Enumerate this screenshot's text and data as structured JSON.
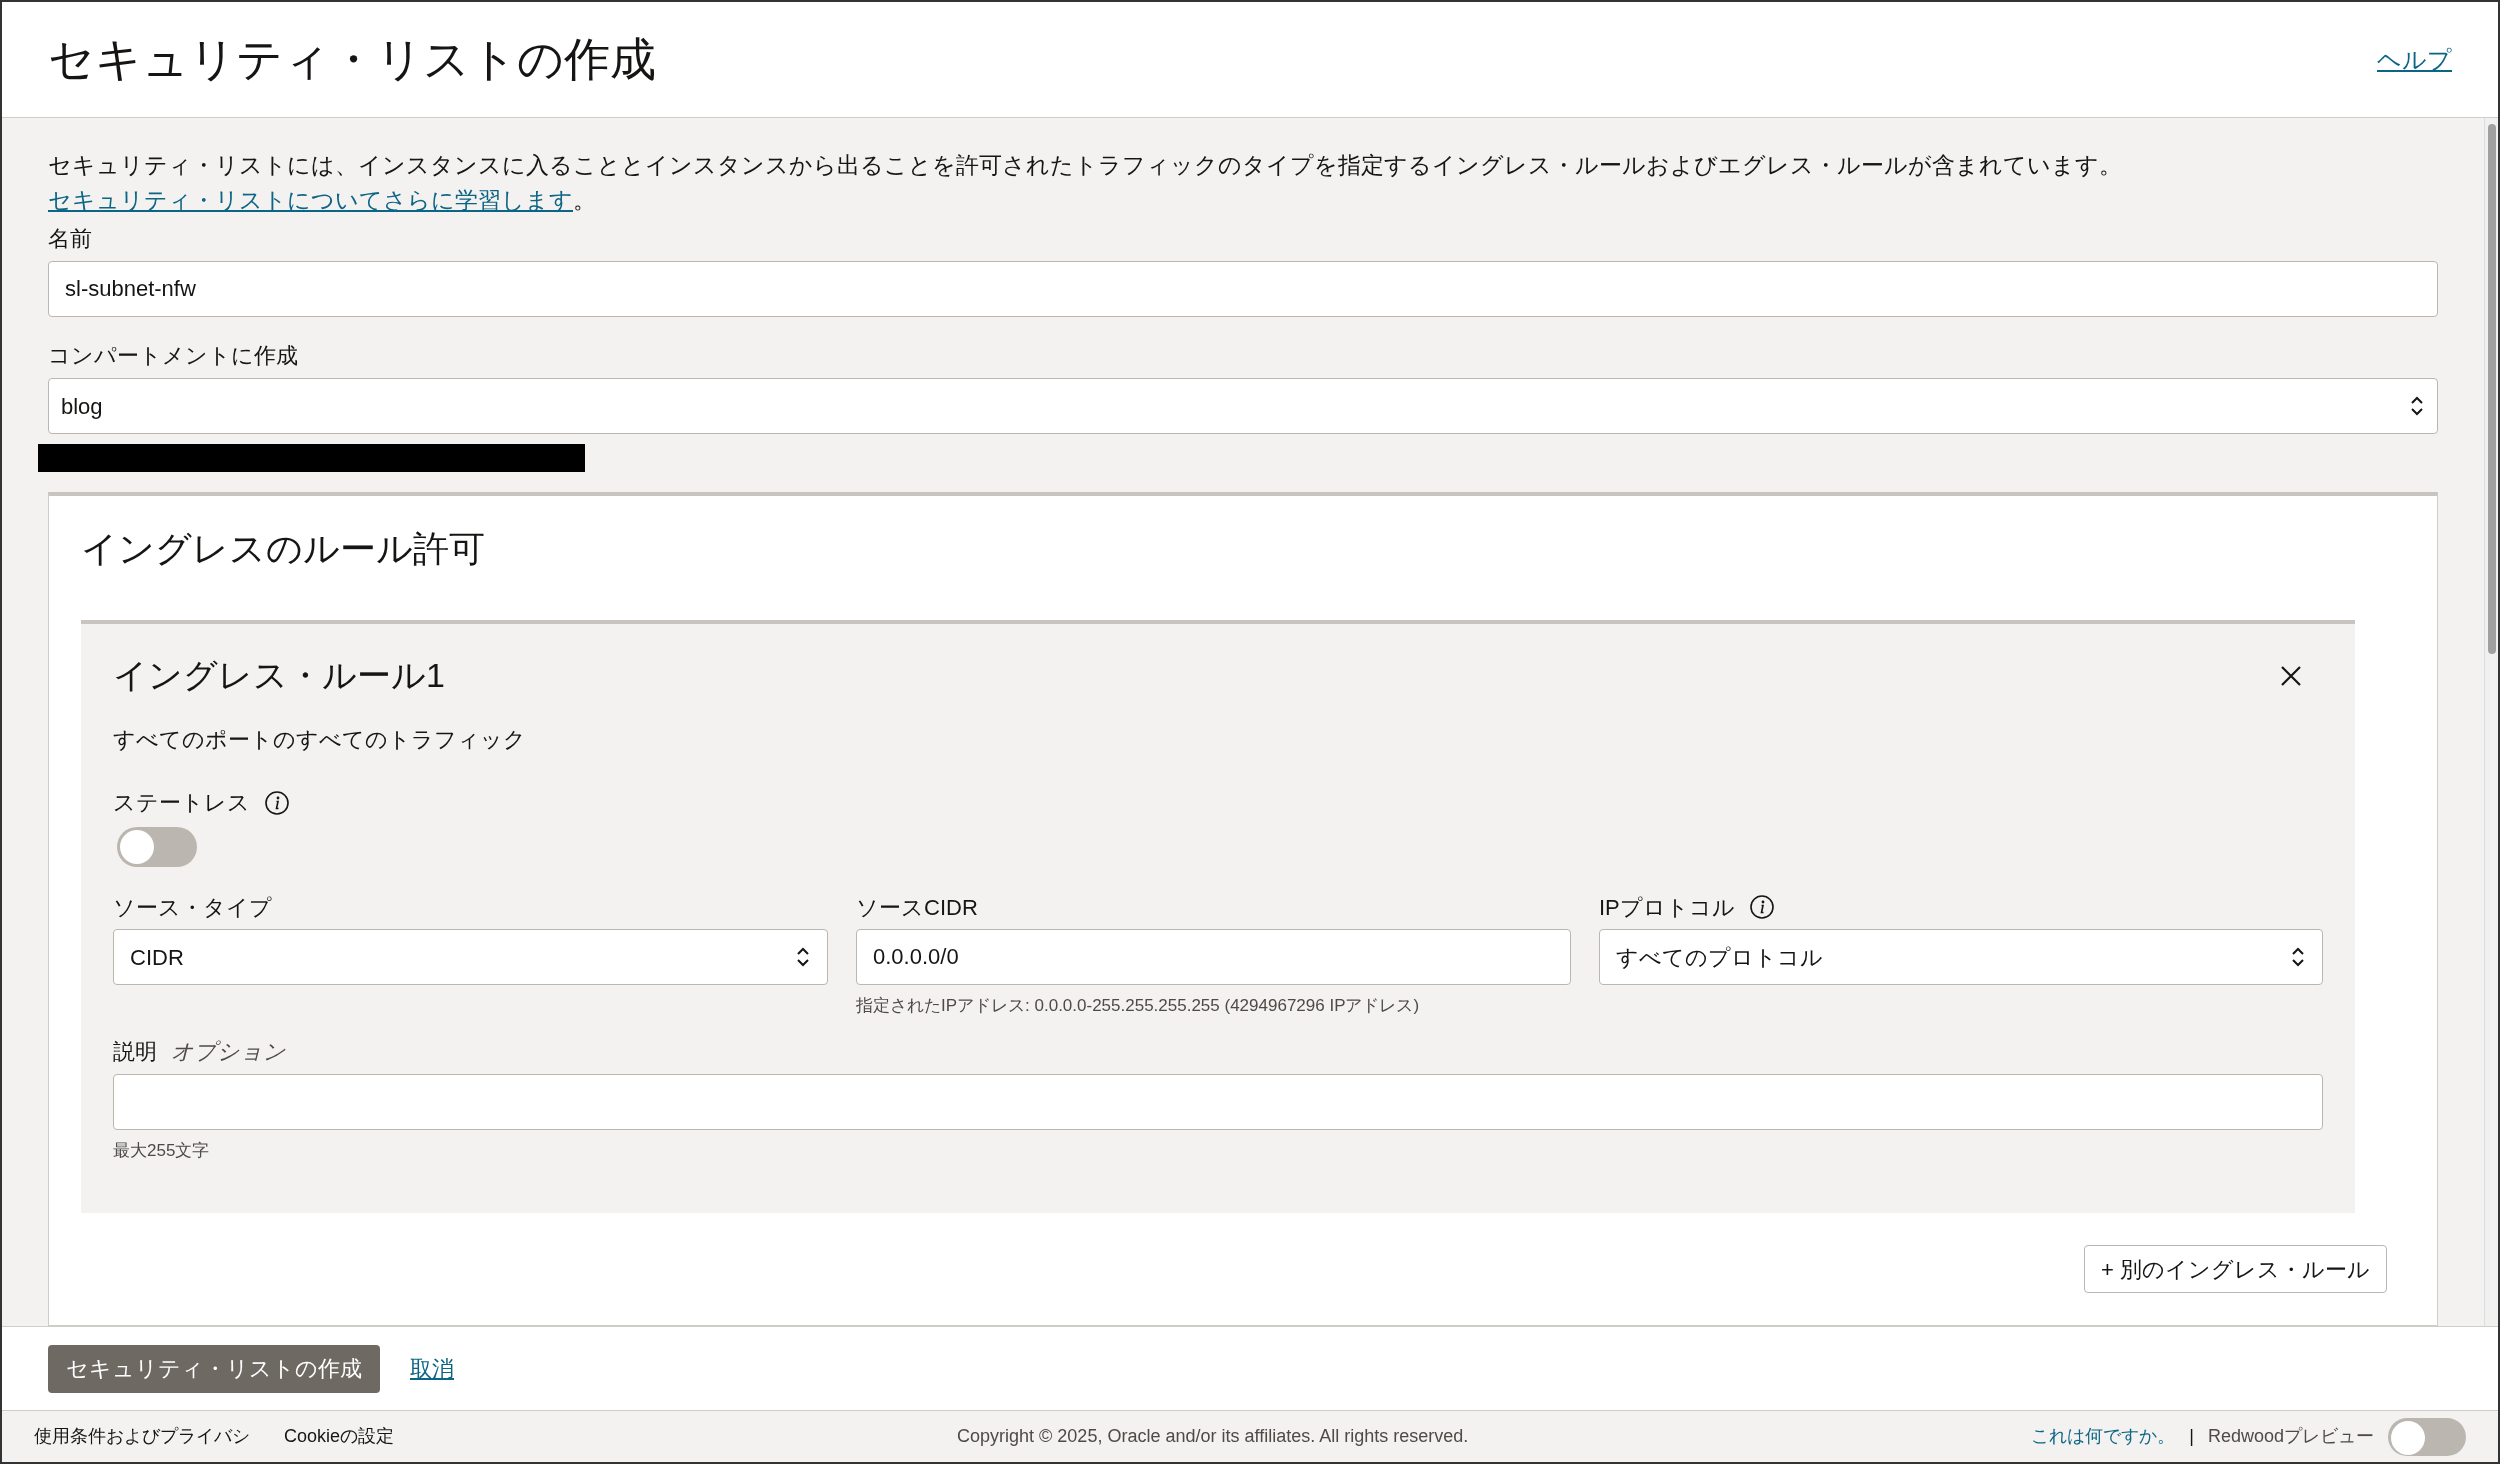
{
  "header": {
    "title": "セキュリティ・リストの作成",
    "help_link": "ヘルプ"
  },
  "intro": {
    "text": "セキュリティ・リストには、インスタンスに入ることとインスタンスから出ることを許可されたトラフィックのタイプを指定するイングレス・ルールおよびエグレス・ルールが含まれています。",
    "link": "セキュリティ・リストについてさらに学習します",
    "end": "。"
  },
  "name_field": {
    "label": "名前",
    "value": "sl-subnet-nfw"
  },
  "compartment_field": {
    "label": "コンパートメントに作成",
    "value": "blog"
  },
  "ingress": {
    "title": "イングレスのルール許可",
    "rule": {
      "title": "イングレス・ルール1",
      "summary": "すべてのポートのすべてのトラフィック",
      "stateless": {
        "label": "ステートレス",
        "on": false
      },
      "source_type": {
        "label": "ソース・タイプ",
        "value": "CIDR"
      },
      "source_cidr": {
        "label": "ソースCIDR",
        "value": "0.0.0.0/0",
        "help": "指定されたIPアドレス: 0.0.0.0-255.255.255.255 (4294967296 IPアドレス)"
      },
      "ip_protocol": {
        "label": "IPプロトコル",
        "value": "すべてのプロトコル"
      },
      "description": {
        "label": "説明",
        "optional": "オプション",
        "help": "最大255文字"
      }
    },
    "add_button": "+ 別のイングレス・ルール"
  },
  "actions": {
    "primary": "セキュリティ・リストの作成",
    "cancel": "取消"
  },
  "footer": {
    "terms": "使用条件およびプライバシ",
    "cookies": "Cookieの設定",
    "copyright": "Copyright © 2025, Oracle and/or its affiliates. All rights reserved.",
    "what_is_this": "これは何ですか。",
    "separator": "|",
    "preview_label": "Redwoodプレビュー",
    "preview_on": false
  }
}
